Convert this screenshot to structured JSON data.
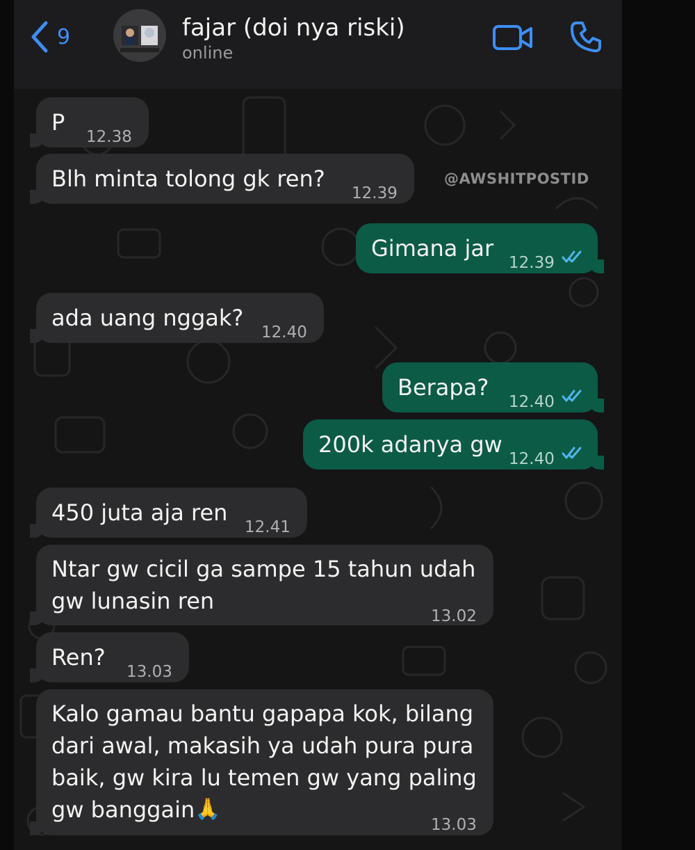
{
  "header": {
    "back_count": "9",
    "contact_name": "fajar (doi nya riski)",
    "status": "online"
  },
  "watermark": "@AWSHITPOSTID",
  "icons": {
    "back": "chevron-left-icon",
    "video": "video-call-icon",
    "call": "phone-icon",
    "read": "double-check-icon",
    "prayer": "folded-hands-emoji"
  },
  "colors": {
    "accent": "#3d8ef5",
    "incoming_bubble": "#2c2c2e",
    "outgoing_bubble": "#0b5b47",
    "read_ticks": "#4fb6ec"
  },
  "messages": [
    {
      "direction": "in",
      "text": "P",
      "time": "12.38"
    },
    {
      "direction": "in",
      "text": "Blh minta tolong gk ren?",
      "time": "12.39"
    },
    {
      "direction": "out",
      "text": "Gimana jar",
      "time": "12.39",
      "status": "read"
    },
    {
      "direction": "in",
      "text": "ada uang nggak?",
      "time": "12.40"
    },
    {
      "direction": "out",
      "text": "Berapa?",
      "time": "12.40",
      "status": "read"
    },
    {
      "direction": "out",
      "text": "200k adanya gw",
      "time": "12.40",
      "status": "read"
    },
    {
      "direction": "in",
      "text": "450 juta aja ren",
      "time": "12.41"
    },
    {
      "direction": "in",
      "lines": [
        "Ntar gw cicil ga sampe 15 tahun udah",
        "gw lunasin ren"
      ],
      "time": "13.02"
    },
    {
      "direction": "in",
      "text": "Ren?",
      "time": "13.03"
    },
    {
      "direction": "in",
      "lines": [
        "Kalo gamau bantu gapapa kok, bilang",
        "dari awal, makasih ya udah pura pura",
        "baik, gw kira lu temen gw yang paling",
        "gw banggain"
      ],
      "emoji": "🙏",
      "time": "13.03"
    }
  ]
}
